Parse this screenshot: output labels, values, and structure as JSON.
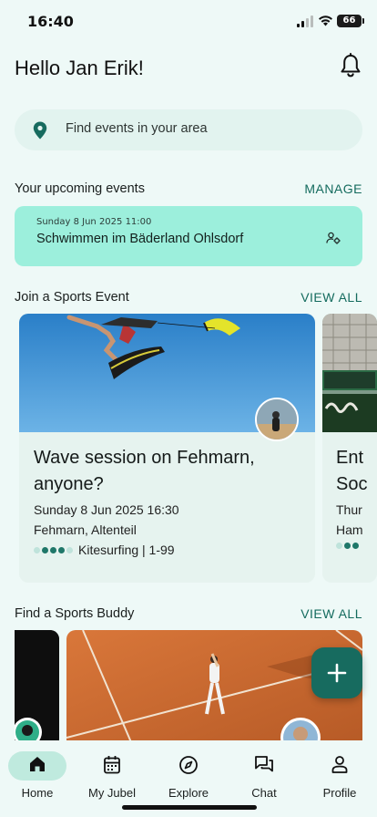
{
  "status_bar": {
    "time": "16:40",
    "battery": "66"
  },
  "header": {
    "greeting": "Hello Jan Erik!",
    "bell_icon": "bell-icon"
  },
  "search": {
    "placeholder": "Find events in your area",
    "icon": "location-pin-icon"
  },
  "upcoming": {
    "title": "Your upcoming events",
    "link": "MANAGE",
    "event": {
      "date": "Sunday 8 Jun 2025 11:00",
      "title": "Schwimmen im Bäderland Ohlsdorf",
      "icon": "group-settings-icon"
    }
  },
  "sports_events": {
    "title": "Join a Sports Event",
    "link": "VIEW ALL",
    "cards": [
      {
        "title": "Wave session on Fehmarn, anyone?",
        "date": "Sunday 8 Jun 2025 16:30",
        "location": "Fehmarn, Altenteil",
        "sport": "Kitesurfing | 1-99",
        "level_filled": 3,
        "level_total": 5
      },
      {
        "title": "Ent\nSoc",
        "date": "Thur",
        "location": "Ham",
        "level_filled": 2,
        "level_total": 5
      }
    ]
  },
  "buddy": {
    "title": "Find a Sports Buddy",
    "link": "VIEW ALL"
  },
  "fab": {
    "icon": "plus-icon"
  },
  "tabs": [
    {
      "label": "Home",
      "icon": "home-icon",
      "active": true
    },
    {
      "label": "My Jubel",
      "icon": "calendar-icon"
    },
    {
      "label": "Explore",
      "icon": "compass-icon"
    },
    {
      "label": "Chat",
      "icon": "chat-icon"
    },
    {
      "label": "Profile",
      "icon": "person-icon"
    }
  ],
  "colors": {
    "accent": "#176b5f",
    "mint": "#9cefdc",
    "background": "#eef9f7"
  }
}
